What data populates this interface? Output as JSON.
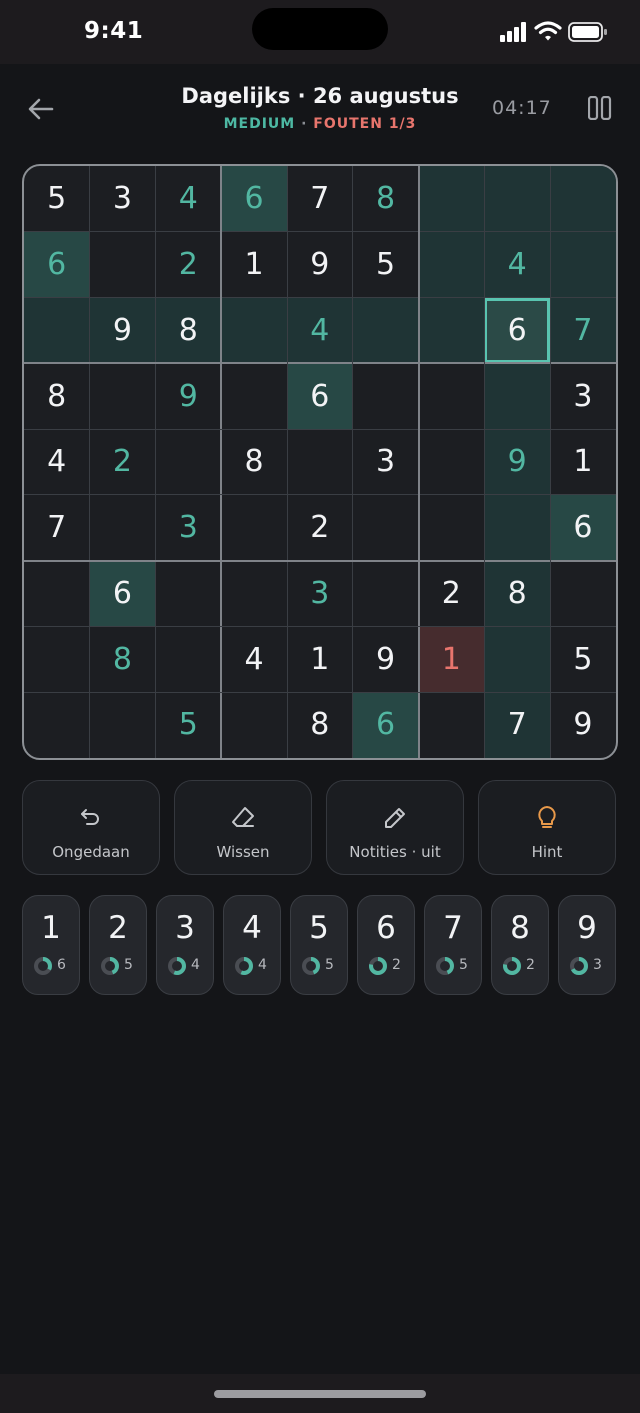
{
  "status_bar": {
    "time": "9:41"
  },
  "header": {
    "title": "Dagelijks · 26 augustus",
    "difficulty": "MEDIUM",
    "separator": " · ",
    "errors": "FOUTEN 1/3",
    "timer": "04:17"
  },
  "board": {
    "rows": [
      [
        "5",
        "3",
        "4",
        "6",
        "7",
        "8",
        "",
        "",
        ""
      ],
      [
        "6",
        "",
        "2",
        "1",
        "9",
        "5",
        "",
        "4",
        ""
      ],
      [
        "",
        "9",
        "8",
        "",
        "4",
        "",
        "",
        "6",
        "7"
      ],
      [
        "8",
        "",
        "9",
        "",
        "6",
        "",
        "",
        "",
        "3"
      ],
      [
        "4",
        "2",
        "",
        "8",
        "",
        "3",
        "",
        "9",
        "1"
      ],
      [
        "7",
        "",
        "3",
        "",
        "2",
        "",
        "",
        "",
        "6"
      ],
      [
        "",
        "6",
        "",
        "",
        "3",
        "",
        "2",
        "8",
        ""
      ],
      [
        "",
        "8",
        "",
        "4",
        "1",
        "9",
        "1",
        "",
        "5"
      ],
      [
        "",
        "",
        "5",
        "",
        "8",
        "6",
        "",
        "7",
        "9"
      ]
    ],
    "kinds": [
      [
        "g",
        "g",
        "u",
        "u",
        "g",
        "u",
        "",
        "",
        ""
      ],
      [
        "u",
        "",
        "u",
        "g",
        "g",
        "g",
        "",
        "u",
        ""
      ],
      [
        "",
        "g",
        "g",
        "",
        "u",
        "",
        "",
        "g",
        "u"
      ],
      [
        "g",
        "",
        "u",
        "",
        "g",
        "",
        "",
        "",
        "g"
      ],
      [
        "g",
        "u",
        "",
        "g",
        "",
        "g",
        "",
        "u",
        "g"
      ],
      [
        "g",
        "",
        "u",
        "",
        "g",
        "",
        "",
        "",
        "g"
      ],
      [
        "",
        "g",
        "",
        "",
        "u",
        "",
        "g",
        "g",
        ""
      ],
      [
        "",
        "u",
        "",
        "g",
        "g",
        "g",
        "e",
        "",
        "g"
      ],
      [
        "",
        "",
        "u",
        "",
        "g",
        "u",
        "",
        "g",
        "g"
      ]
    ],
    "selected": {
      "row": 2,
      "col": 7
    },
    "error_cells": [
      [
        7,
        6
      ]
    ]
  },
  "tools": [
    {
      "label": "Ongedaan",
      "icon": "undo-icon"
    },
    {
      "label": "Wissen",
      "icon": "eraser-icon"
    },
    {
      "label": "Notities · uit",
      "icon": "pencil-icon"
    },
    {
      "label": "Hint",
      "icon": "lightbulb-icon"
    }
  ],
  "numpad": [
    {
      "digit": "1",
      "remaining": "6",
      "progress": 0.33
    },
    {
      "digit": "2",
      "remaining": "5",
      "progress": 0.44
    },
    {
      "digit": "3",
      "remaining": "4",
      "progress": 0.56
    },
    {
      "digit": "4",
      "remaining": "4",
      "progress": 0.56
    },
    {
      "digit": "5",
      "remaining": "5",
      "progress": 0.44
    },
    {
      "digit": "6",
      "remaining": "2",
      "progress": 0.78
    },
    {
      "digit": "7",
      "remaining": "5",
      "progress": 0.44
    },
    {
      "digit": "8",
      "remaining": "2",
      "progress": 0.78
    },
    {
      "digit": "9",
      "remaining": "3",
      "progress": 0.67
    }
  ],
  "colors": {
    "accent": "#52b7a2",
    "error": "#e8756d",
    "hint": "#e8994a",
    "background": "#141518"
  }
}
